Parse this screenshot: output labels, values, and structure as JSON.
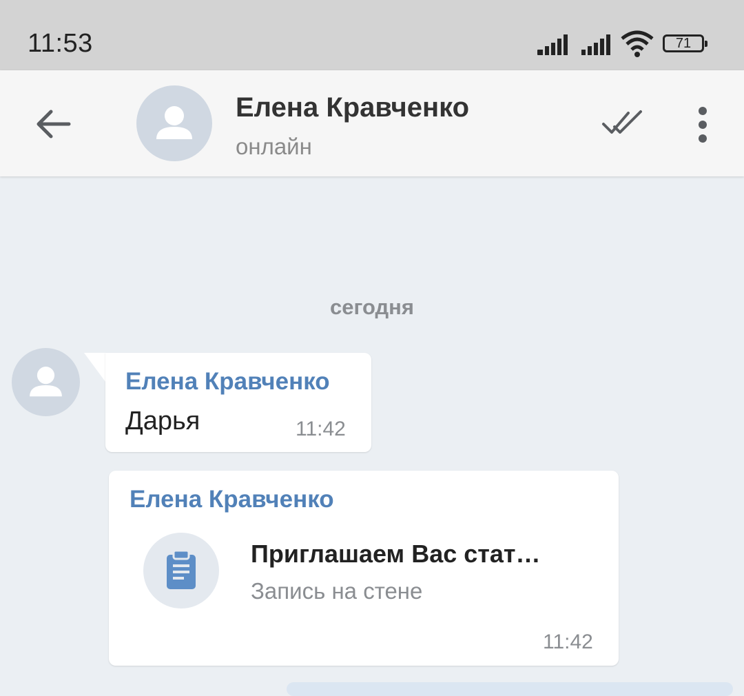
{
  "status_bar": {
    "time": "11:53",
    "battery": "71",
    "icons": [
      "signal-icon",
      "signal-icon",
      "wifi-icon",
      "battery-icon"
    ]
  },
  "header": {
    "contact_name": "Елена Кравченко",
    "contact_status": "онлайн",
    "icons": [
      "back-arrow-icon",
      "avatar-icon",
      "double-check-icon",
      "more-vert-icon"
    ]
  },
  "chat": {
    "date_separator": "сегодня",
    "messages": [
      {
        "sender": "Елена Кравченко",
        "text": "Дарья",
        "time": "11:42"
      },
      {
        "sender": "Елена Кравченко",
        "attachment": {
          "icon": "clipboard-icon",
          "title": "Приглашаем Вас стат…",
          "subtitle": "Запись на стене"
        },
        "time": "11:42"
      }
    ]
  },
  "colors": {
    "background": "#ebeff3",
    "accent": "#5181b8",
    "status_bar": "#d3d3d3",
    "header": "#f6f6f6"
  }
}
